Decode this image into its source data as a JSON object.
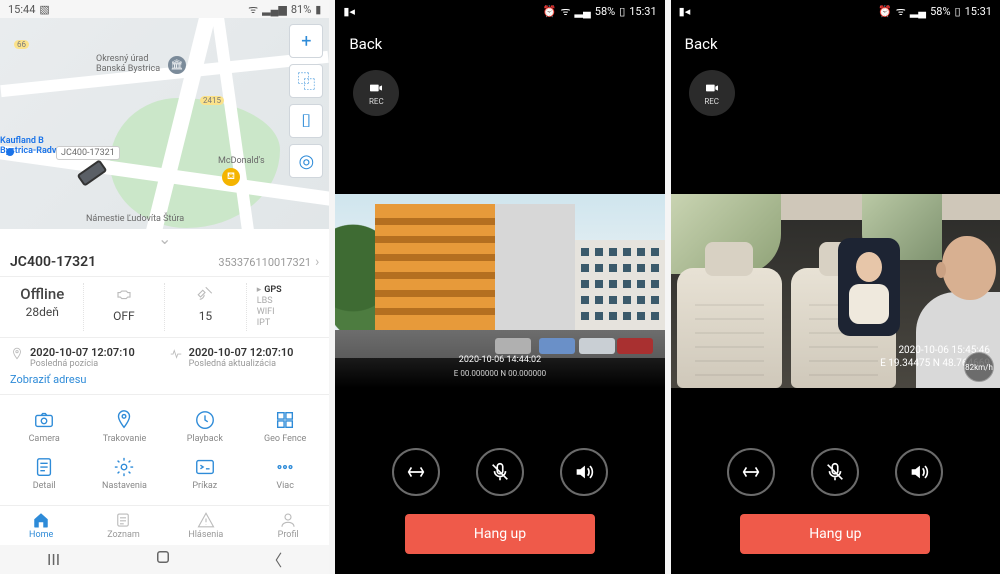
{
  "phone1": {
    "status": {
      "time": "15:44",
      "signal": "📷",
      "wifi": true,
      "battery": "81%"
    },
    "map": {
      "labels": {
        "office": "Okresný úrad\nBanská Bystrica",
        "kaufland": "Kaufland B\nBystrica-Radvan",
        "mcd": "McDonald's",
        "street1": "Námestie Ľudovíta Štúra",
        "road_tag1": "66",
        "road_tag2": "2415",
        "device_id": "JC400-17321"
      },
      "buttons": {
        "add": "+",
        "layers": "⿻",
        "type": "⌷",
        "locate": "◎"
      }
    },
    "device": {
      "name": "JC400-17321",
      "imei": "353376110017321"
    },
    "stats": {
      "state_label": "Offline",
      "state_value": "28deň",
      "acc_label": "",
      "acc_value": "OFF",
      "sat_label": "",
      "sat_value": "15",
      "loc": {
        "active": "GPS",
        "others": [
          "LBS",
          "WIFI",
          "IPT"
        ]
      }
    },
    "timestamps": {
      "pos": {
        "time": "2020-10-07 12:07:10",
        "label": "Posledná pozícia"
      },
      "upd": {
        "time": "2020-10-07 12:07:10",
        "label": "Posledná aktualizácia"
      }
    },
    "address_link": "Zobraziť adresu",
    "actions": {
      "row": [
        {
          "key": "camera",
          "label": "Camera"
        },
        {
          "key": "tracking",
          "label": "Trakovanie"
        },
        {
          "key": "playback",
          "label": "Playback"
        },
        {
          "key": "geofence",
          "label": "Geo Fence"
        },
        {
          "key": "detail",
          "label": "Detail"
        },
        {
          "key": "settings",
          "label": "Nastavenia"
        },
        {
          "key": "command",
          "label": "Príkaz"
        },
        {
          "key": "more",
          "label": "Viac"
        }
      ]
    },
    "tabs": {
      "home": "Home",
      "list": "Zoznam",
      "alerts": "Hlásenia",
      "profile": "Profil"
    }
  },
  "phone2": {
    "status": {
      "time": "15:31",
      "battery": "58%"
    },
    "back": "Back",
    "rec": "REC",
    "overlay": {
      "line1": "2020-10-06  14:44:02",
      "line2": "E 00.000000  N 00.000000"
    },
    "controls": {
      "switch": "switch-camera",
      "mic": "mic-mute",
      "sound": "sound"
    },
    "hang": "Hang up"
  },
  "phone3": {
    "status": {
      "time": "15:31",
      "battery": "58%"
    },
    "back": "Back",
    "rec": "REC",
    "overlay": {
      "line1": "2020-10-06   15:45:46",
      "line2": "E 19.34475   N 48.764669",
      "speed": "82km/h"
    },
    "controls": {
      "switch": "switch-camera",
      "mic": "mic-mute",
      "sound": "sound"
    },
    "hang": "Hang up"
  }
}
